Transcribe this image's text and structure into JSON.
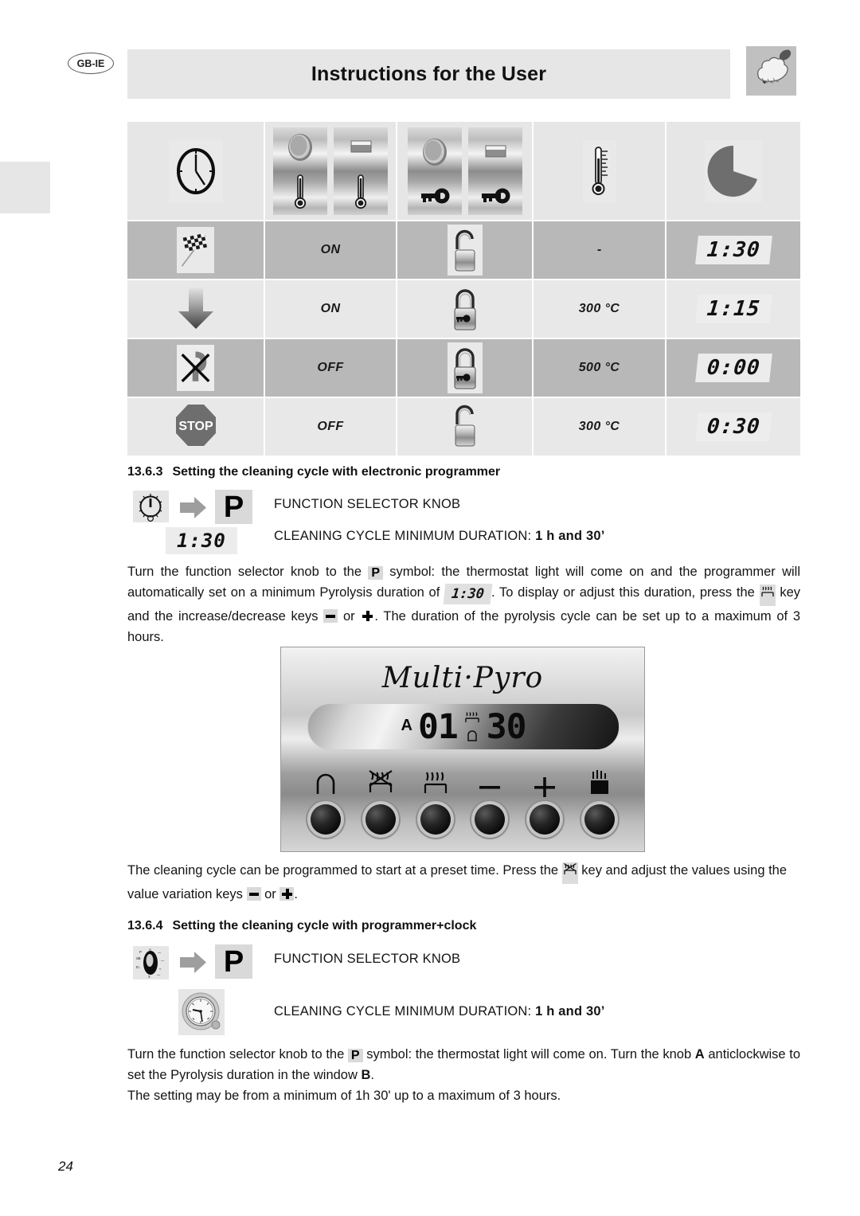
{
  "header": {
    "locale_badge": "GB-IE",
    "title": "Instructions for the User",
    "chef_icon": "chef-hat-spoon-icon"
  },
  "table": {
    "header_row": {
      "col0_icon": "clock-icon",
      "col1_icons": [
        "knob-thermostat-icon",
        "switch-thermostat-icon",
        "knob-key-icon",
        "switch-key-icon"
      ],
      "col3_icon": "thermometer-icon",
      "col4_icon": "pie-wedge-icon"
    },
    "rows": [
      {
        "status_icon": "checkered-flag-icon",
        "state": "ON",
        "lock_icon": "padlock-open-icon",
        "temperature": "-",
        "time": "1:30"
      },
      {
        "status_icon": "down-arrow-icon",
        "state": "ON",
        "lock_icon": "padlock-closed-icon",
        "temperature": "300 °C",
        "time": "1:15"
      },
      {
        "status_icon": "cancel-cross-icon",
        "state": "OFF",
        "lock_icon": "padlock-closed-icon",
        "temperature": "500 °C",
        "time": "0:00"
      },
      {
        "status_icon": "stop-sign-icon",
        "state": "OFF",
        "lock_icon": "padlock-open-icon",
        "temperature": "300 °C",
        "time": "0:30"
      }
    ]
  },
  "section_1363": {
    "number": "13.6.3",
    "title": "Setting the cleaning cycle with electronic programmer",
    "knob_icon": "function-selector-knob-icon",
    "arrow_icon": "right-arrow-icon",
    "p_symbol": "P",
    "knob_label": "FUNCTION SELECTOR KNOB",
    "duration_chip": "1:30",
    "duration_label_plain": "CLEANING CYCLE MINIMUM DURATION: ",
    "duration_label_bold": "1 h and 30’",
    "paragraph": {
      "part1": "Turn the function selector knob to the ",
      "p_key": "P",
      "part2": " symbol: the thermostat light will come on and the programmer will automatically set on a minimum Pyrolysis duration of ",
      "time_chip": "1:30",
      "part3": ". To display or adjust this duration, press the ",
      "pyro_key": "pyrolysis-key-icon",
      "part4": " key and the increase/decrease keys ",
      "minus_key": "minus-key-icon",
      "part5": " or ",
      "plus_key": "plus-key-icon",
      "part6": ". The duration of the pyrolysis cycle can be set up to a maximum of 3 hours."
    }
  },
  "control_panel": {
    "brand": "Multi·Pyro",
    "display": {
      "mode_letter": "A",
      "hours": "01",
      "minutes": "30",
      "separator_top_icon": "heating-element-icon",
      "separator_bottom_icon": "bell-icon"
    },
    "keys": [
      {
        "icon": "bell-icon",
        "name": "timer-bell-key"
      },
      {
        "icon": "pyrolysis-crossed-icon",
        "name": "pyrolysis-key"
      },
      {
        "icon": "heating-element-icon",
        "name": "cooking-duration-key"
      },
      {
        "icon": "minus-icon",
        "name": "decrease-key"
      },
      {
        "icon": "plus-icon",
        "name": "increase-key"
      },
      {
        "icon": "manual-hand-icon",
        "name": "manual-key"
      }
    ]
  },
  "paragraph_preset": {
    "part1": "The cleaning cycle can be programmed to start at a preset time. Press the ",
    "pyro_key": "pyrolysis-key-icon",
    "part2": " key and adjust the values using the value variation keys ",
    "minus_key": "minus-key-icon",
    "part3": " or ",
    "plus_key": "plus-key-icon",
    "part4": "."
  },
  "section_1364": {
    "number": "13.6.4",
    "title": "Setting the cleaning cycle with programmer+clock",
    "knob_icon": "function-selector-knob-icon",
    "arrow_icon": "right-arrow-icon",
    "p_symbol": "P",
    "knob_label": "FUNCTION SELECTOR KNOB",
    "clock_icon": "analogue-clock-timer-icon",
    "duration_label_plain": "CLEANING CYCLE MINIMUM DURATION: ",
    "duration_label_bold": "1 h and 30’",
    "paragraph": {
      "part1": "Turn the function selector knob to the ",
      "p_key": "P",
      "part2": " symbol: the thermostat light will come on. Turn the knob ",
      "knob_a": "A",
      "part3": " anticlockwise to set the Pyrolysis duration in the window ",
      "window_b": "B",
      "part4": ".",
      "line3": "The setting may be from a minimum of 1h 30' up to a maximum of 3 hours."
    }
  },
  "footer": {
    "page_number": "24"
  },
  "colors": {
    "header_band": "#e6e6e6",
    "row_dark": "#b8b8b8",
    "row_light": "#e8e8e8",
    "text": "#141414"
  }
}
